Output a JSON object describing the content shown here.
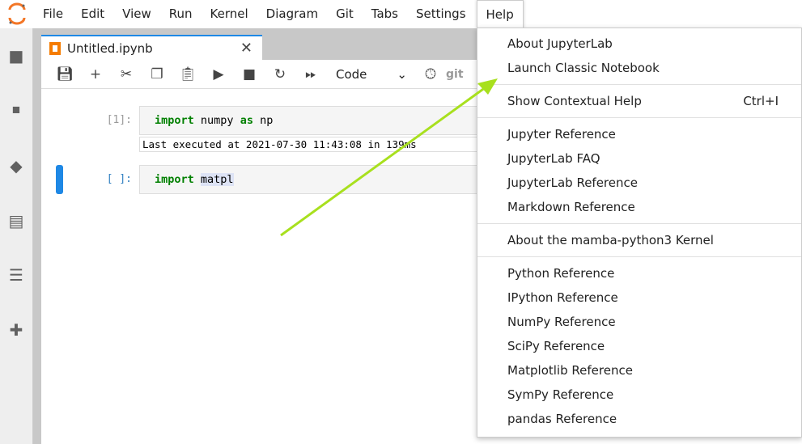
{
  "menubar": {
    "items": [
      "File",
      "Edit",
      "View",
      "Run",
      "Kernel",
      "Diagram",
      "Git",
      "Tabs",
      "Settings",
      "Help"
    ]
  },
  "tab": {
    "label": "Untitled.ipynb"
  },
  "toolbar": {
    "cell_type": "Code",
    "git_label": "git"
  },
  "cells": [
    {
      "prompt": "[1]:",
      "code": [
        {
          "t": "import",
          "kw": true
        },
        {
          "t": " numpy "
        },
        {
          "t": "as",
          "kw": true
        },
        {
          "t": " np"
        }
      ],
      "output": "Last executed at 2021-07-30 11:43:08 in 139ms"
    },
    {
      "prompt": "[ ]:",
      "code": [
        {
          "t": "import",
          "kw": true
        },
        {
          "t": " "
        },
        {
          "t": "matpl",
          "hl": true
        }
      ]
    }
  ],
  "help_menu": {
    "groups": [
      [
        {
          "label": "About JupyterLab"
        },
        {
          "label": "Launch Classic Notebook"
        }
      ],
      [
        {
          "label": "Show Contextual Help",
          "shortcut": "Ctrl+I"
        }
      ],
      [
        {
          "label": "Jupyter Reference"
        },
        {
          "label": "JupyterLab FAQ"
        },
        {
          "label": "JupyterLab Reference"
        },
        {
          "label": "Markdown Reference"
        }
      ],
      [
        {
          "label": "About the mamba-python3 Kernel"
        }
      ],
      [
        {
          "label": "Python Reference"
        },
        {
          "label": "IPython Reference"
        },
        {
          "label": "NumPy Reference"
        },
        {
          "label": "SciPy Reference"
        },
        {
          "label": "Matplotlib Reference"
        },
        {
          "label": "SymPy Reference"
        },
        {
          "label": "pandas Reference"
        }
      ]
    ]
  },
  "colors": {
    "accent": "#1e88e5",
    "annotation_arrow": "#a8e01e",
    "logo": "#f37626"
  }
}
